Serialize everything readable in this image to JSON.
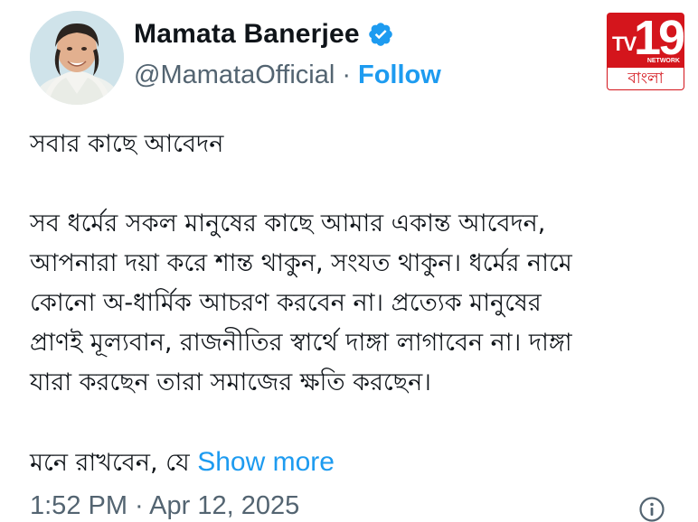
{
  "author": {
    "name": "Mamata Banerjee",
    "handle": "@MamataOfficial",
    "separator": "·",
    "follow_label": "Follow",
    "verified_icon": "verified-badge-icon",
    "accent_color": "#1d9bf0"
  },
  "logo": {
    "brand": "TV",
    "number": "19",
    "network": "NETWORK",
    "language": "বাংলা",
    "color": "#d4151c"
  },
  "post": {
    "title_line": "সবার কাছে আবেদন",
    "paragraph_lines": [
      "সব ধর্মের সকল মানুষের কাছে আমার একান্ত আবেদন,",
      "আপনারা দয়া করে শান্ত থাকুন, সংযত থাকুন। ধর্মের নামে",
      "কোনো অ-ধার্মিক আচরণ করবেন না। প্রত্যেক মানুষের",
      "প্রাণই মূল্যবান,  রাজনীতির স্বার্থে দাঙ্গা লাগাবেন না। দাঙ্গা",
      "যারা করছেন তারা সমাজের ক্ষতি করছেন।"
    ],
    "last_line_start": "মনে রাখবেন, যে",
    "show_more_label": "Show more"
  },
  "meta": {
    "timestamp": "1:52 PM · Apr 12, 2025",
    "info_icon": "info-icon"
  }
}
